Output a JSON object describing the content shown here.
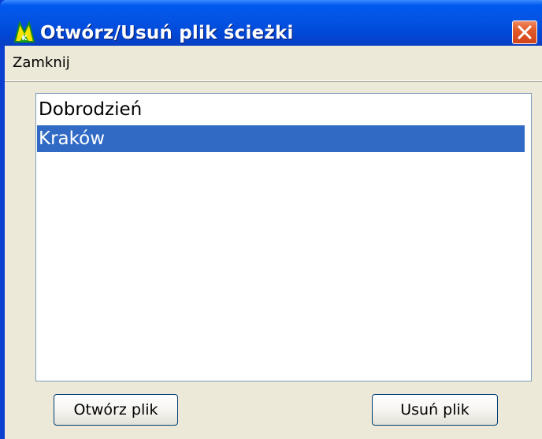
{
  "window": {
    "title": "Otwórz/Usuń plik ścieżki",
    "icon": "mk-logo-icon",
    "accent_color": "#0453e3"
  },
  "menu": {
    "items": [
      {
        "label": "Zamknij"
      }
    ]
  },
  "list": {
    "items": [
      {
        "label": "Dobrodzień",
        "selected": false
      },
      {
        "label": "Kraków",
        "selected": true
      }
    ],
    "selection_color": "#316ac5"
  },
  "buttons": {
    "open_label": "Otwórz plik",
    "delete_label": "Usuń plik"
  }
}
